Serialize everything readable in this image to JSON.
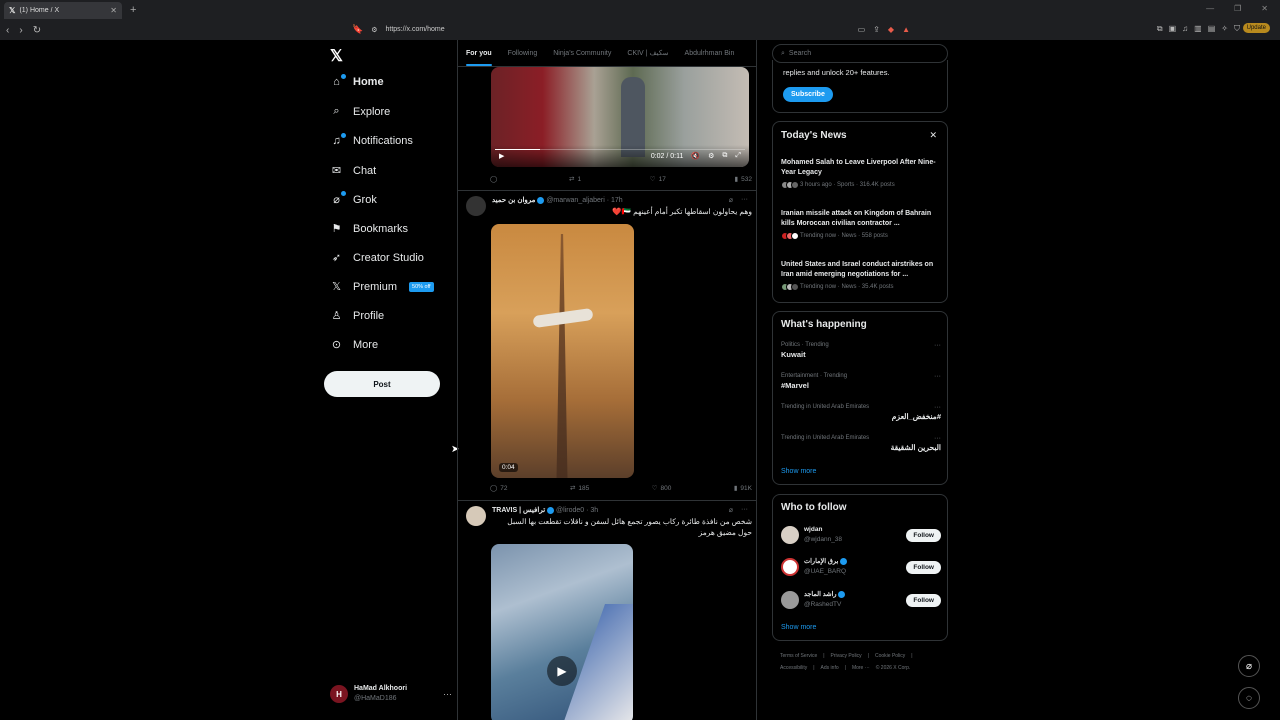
{
  "browser": {
    "tab_title": "(1) Home / X",
    "url": "https://x.com/home",
    "update_label": "Update"
  },
  "nav": {
    "items": [
      {
        "label": "Home",
        "icon": "home-icon"
      },
      {
        "label": "Explore",
        "icon": "search-icon"
      },
      {
        "label": "Notifications",
        "icon": "bell-icon"
      },
      {
        "label": "Chat",
        "icon": "mail-icon"
      },
      {
        "label": "Grok",
        "icon": "grok-icon"
      },
      {
        "label": "Bookmarks",
        "icon": "bookmark-icon"
      },
      {
        "label": "Creator Studio",
        "icon": "rocket-icon"
      },
      {
        "label": "Premium",
        "icon": "x-icon"
      },
      {
        "label": "Profile",
        "icon": "person-icon"
      },
      {
        "label": "More",
        "icon": "more-circle-icon"
      }
    ],
    "premium_badge": "50% off",
    "post_label": "Post",
    "account": {
      "name": "HaMad Alkhoori",
      "handle": "@HaMaD186"
    }
  },
  "feed": {
    "tabs": [
      "For you",
      "Following",
      "Ninja's Community",
      "CKIV | سكيف",
      "Abdulrhman Bin"
    ],
    "post1": {
      "time": "0:02 / 0:11",
      "replies": "",
      "reposts": "1",
      "likes": "17",
      "views": "532"
    },
    "post2": {
      "name": "مروان بن حميد",
      "handle": "@marwan_aljaberi · 17h",
      "text": "وهم يحاولون اسقاطها تكبر أمام أعينهم 🇦🇪❤️",
      "duration": "0:04",
      "replies": "72",
      "reposts": "185",
      "likes": "800",
      "views": "91K"
    },
    "post3": {
      "name": "TRAVIS | ترافيس",
      "handle": "@lirode0 · 3h",
      "text": "شخص من نافذة طائرة ركاب يصور تجمع هائل لسفن و ناقلات تقطعت بها السبل حول مضيق هرمز"
    }
  },
  "right": {
    "search_placeholder": "Search",
    "subscribe": {
      "text": "replies and unlock 20+ features.",
      "button": "Subscribe"
    },
    "news": {
      "title": "Today's News",
      "items": [
        {
          "headline": "Mohamed Salah to Leave Liverpool After Nine-Year Legacy",
          "meta": "3 hours ago · Sports · 316.4K posts"
        },
        {
          "headline": "Iranian missile attack on Kingdom of Bahrain kills Moroccan civilian contractor ...",
          "meta": "Trending now · News · 558 posts"
        },
        {
          "headline": "United States and Israel conduct airstrikes on Iran amid emerging negotiations for ...",
          "meta": "Trending now · News · 35.4K posts"
        }
      ]
    },
    "happening": {
      "title": "What's happening",
      "items": [
        {
          "ctx": "Politics · Trending",
          "name": "Kuwait"
        },
        {
          "ctx": "Entertainment · Trending",
          "name": "#Marvel"
        },
        {
          "ctx": "Trending in United Arab Emirates",
          "name": "#منخفض_العزم"
        },
        {
          "ctx": "Trending in United Arab Emirates",
          "name": "البحرين الشقيقة"
        }
      ],
      "show_more": "Show more"
    },
    "who_to_follow": {
      "title": "Who to follow",
      "items": [
        {
          "name": "wjdan",
          "handle": "@wjdann_38"
        },
        {
          "name": "برق الإمارات",
          "handle": "@UAE_BARQ"
        },
        {
          "name": "راشد الماجد",
          "handle": "@RashedTV"
        }
      ],
      "follow_label": "Follow",
      "show_more": "Show more"
    },
    "footer": [
      "Terms of Service",
      "|",
      "Privacy Policy",
      "|",
      "Cookie Policy",
      "|",
      "Accessibility",
      "|",
      "Ads info",
      "|",
      "More ···",
      "© 2026 X Corp."
    ]
  }
}
